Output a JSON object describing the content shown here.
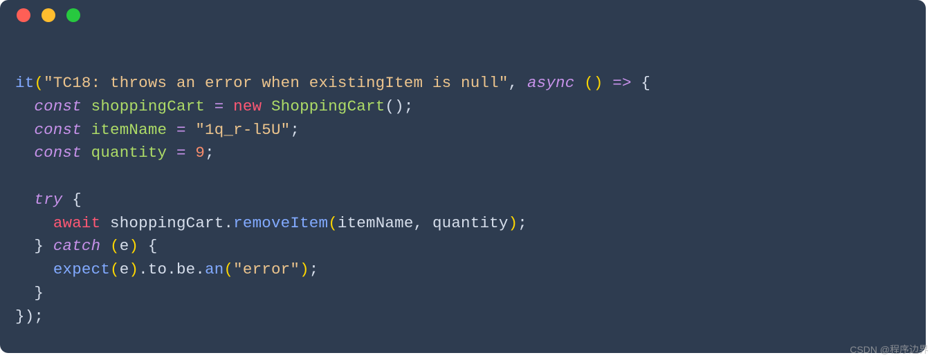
{
  "code": {
    "fn_it": "it",
    "test_name": "\"TC18: throws an error when existingItem is null\"",
    "kw_async": "async",
    "arrow_open": "() ",
    "arrow": "=>",
    "brace_open": " {",
    "kw_const": "const",
    "var_shoppingCart": "shoppingCart",
    "eq": "=",
    "kw_new": "new",
    "class_ShoppingCart": "ShoppingCart",
    "ctor_call": "();",
    "var_itemName": "itemName",
    "str_itemNameVal": "\"1q_r-l5U\"",
    "semi": ";",
    "var_quantity": "quantity",
    "num_quantity": "9",
    "kw_try": "try",
    "brace_open2": "{",
    "kw_await": "await",
    "ref_shoppingCart": "shoppingCart",
    "dot": ".",
    "method_removeItem": "removeItem",
    "paren_open": "(",
    "arg_itemName": "itemName",
    "comma": ", ",
    "arg_quantity": "quantity",
    "paren_close_semi": ");",
    "brace_close": "}",
    "kw_catch": "catch",
    "catch_open": "(",
    "catch_param": "e",
    "catch_close": ") {",
    "fn_expect": "expect",
    "expect_arg": "e",
    "chain_to": "to",
    "chain_be": "be",
    "method_an": "an",
    "str_error": "\"error\"",
    "close_block": "}",
    "close_all": "});"
  },
  "watermark": "CSDN @程序边界"
}
